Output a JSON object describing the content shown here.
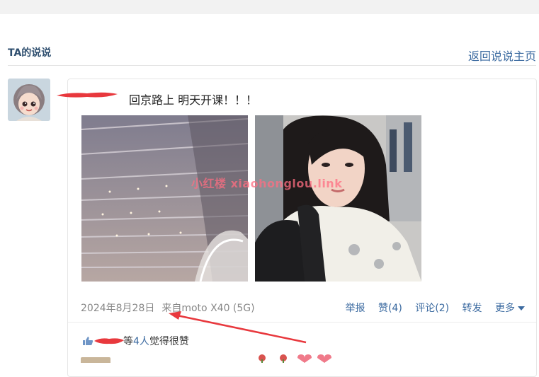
{
  "page": {
    "section_title": "TA的说说",
    "back_link": "返回说说主页"
  },
  "post": {
    "text": "回京路上 明天开课！！！",
    "date": "2024年8月28日",
    "source": "来自moto X40 (5G)",
    "watermark": "小红楼  xiaohonglou.link",
    "actions": {
      "report": "举报",
      "like": "赞(4)",
      "comment": "评论(2)",
      "repost": "转发",
      "more": "更多"
    },
    "likes": {
      "prefix": "等",
      "count": "4人",
      "suffix": "觉得很赞"
    }
  },
  "colors": {
    "link": "#3b6aa0",
    "title": "#2f4f6f",
    "meta": "#888888",
    "annotation_red": "#e8383d"
  }
}
